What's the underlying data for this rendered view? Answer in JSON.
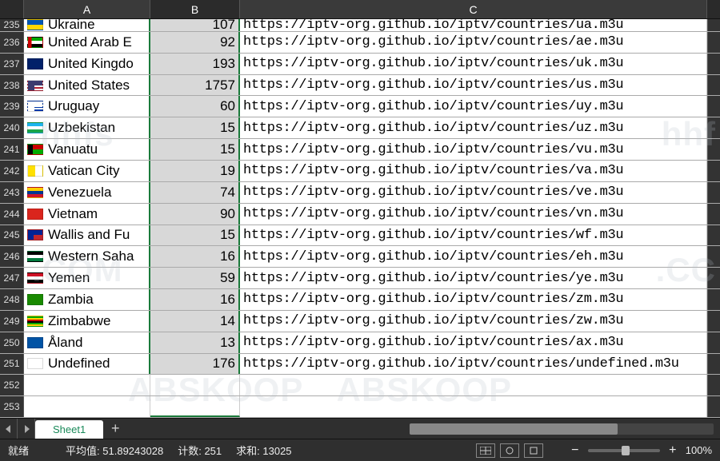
{
  "columns": [
    "A",
    "B",
    "C"
  ],
  "selected_column": "B",
  "rows": [
    {
      "num": 235,
      "partial": true,
      "flag": "ua",
      "country": "Ukraine",
      "count": 107,
      "url": "https://iptv-org.github.io/iptv/countries/ua.m3u"
    },
    {
      "num": 236,
      "partial": false,
      "flag": "ae",
      "country": "United Arab E",
      "count": 92,
      "url": "https://iptv-org.github.io/iptv/countries/ae.m3u"
    },
    {
      "num": 237,
      "partial": false,
      "flag": "uk",
      "country": "United Kingdo",
      "count": 193,
      "url": "https://iptv-org.github.io/iptv/countries/uk.m3u"
    },
    {
      "num": 238,
      "partial": false,
      "flag": "us",
      "country": "United States",
      "count": 1757,
      "url": "https://iptv-org.github.io/iptv/countries/us.m3u"
    },
    {
      "num": 239,
      "partial": false,
      "flag": "uy",
      "country": "Uruguay",
      "count": 60,
      "url": "https://iptv-org.github.io/iptv/countries/uy.m3u"
    },
    {
      "num": 240,
      "partial": false,
      "flag": "uz",
      "country": "Uzbekistan",
      "count": 15,
      "url": "https://iptv-org.github.io/iptv/countries/uz.m3u"
    },
    {
      "num": 241,
      "partial": false,
      "flag": "vu",
      "country": "Vanuatu",
      "count": 15,
      "url": "https://iptv-org.github.io/iptv/countries/vu.m3u"
    },
    {
      "num": 242,
      "partial": false,
      "flag": "va",
      "country": "Vatican City",
      "count": 19,
      "url": "https://iptv-org.github.io/iptv/countries/va.m3u"
    },
    {
      "num": 243,
      "partial": false,
      "flag": "ve",
      "country": "Venezuela",
      "count": 74,
      "url": "https://iptv-org.github.io/iptv/countries/ve.m3u"
    },
    {
      "num": 244,
      "partial": false,
      "flag": "vn",
      "country": "Vietnam",
      "count": 90,
      "url": "https://iptv-org.github.io/iptv/countries/vn.m3u"
    },
    {
      "num": 245,
      "partial": false,
      "flag": "wf",
      "country": "Wallis and Fu",
      "count": 15,
      "url": "https://iptv-org.github.io/iptv/countries/wf.m3u"
    },
    {
      "num": 246,
      "partial": false,
      "flag": "eh",
      "country": "Western Saha",
      "count": 16,
      "url": "https://iptv-org.github.io/iptv/countries/eh.m3u"
    },
    {
      "num": 247,
      "partial": false,
      "flag": "ye",
      "country": "Yemen",
      "count": 59,
      "url": "https://iptv-org.github.io/iptv/countries/ye.m3u"
    },
    {
      "num": 248,
      "partial": false,
      "flag": "zm",
      "country": "Zambia",
      "count": 16,
      "url": "https://iptv-org.github.io/iptv/countries/zm.m3u"
    },
    {
      "num": 249,
      "partial": false,
      "flag": "zw",
      "country": "Zimbabwe",
      "count": 14,
      "url": "https://iptv-org.github.io/iptv/countries/zw.m3u"
    },
    {
      "num": 250,
      "partial": false,
      "flag": "ax",
      "country": "Åland",
      "count": 13,
      "url": "https://iptv-org.github.io/iptv/countries/ax.m3u"
    },
    {
      "num": 251,
      "partial": false,
      "flag": "none",
      "country": "Undefined",
      "count": 176,
      "url": "https://iptv-org.github.io/iptv/countries/undefined.m3u"
    }
  ],
  "empty_rows": [
    252,
    253
  ],
  "sheet_tab": "Sheet1",
  "status": {
    "ready": "就绪",
    "avg_label": "平均值:",
    "avg_value": "51.89243028",
    "count_label": "计数:",
    "count_value": "251",
    "sum_label": "求和:",
    "sum_value": "13025",
    "zoom": "100%"
  }
}
